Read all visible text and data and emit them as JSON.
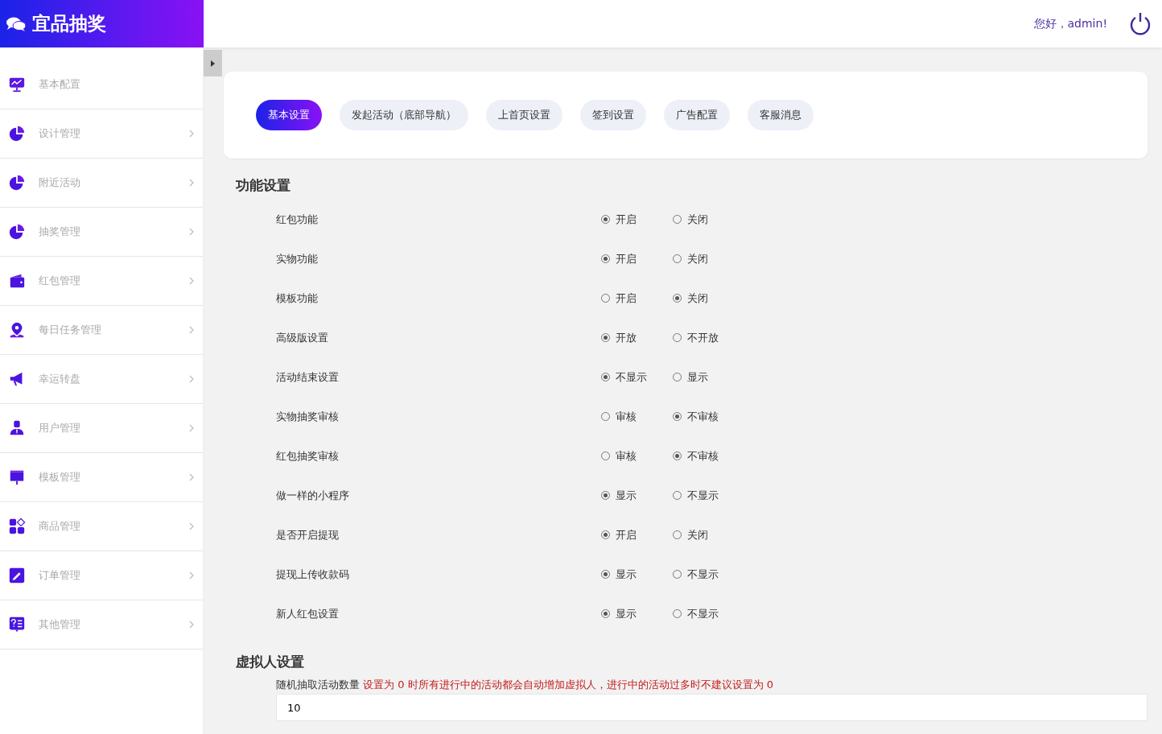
{
  "brand": {
    "title": "宜品抽奖"
  },
  "header": {
    "greeting": "您好，admin!"
  },
  "sidebar": {
    "items": [
      {
        "label": "基本配置",
        "expandable": false
      },
      {
        "label": "设计管理",
        "expandable": true
      },
      {
        "label": "附近活动",
        "expandable": true
      },
      {
        "label": "抽奖管理",
        "expandable": true
      },
      {
        "label": "红包管理",
        "expandable": true
      },
      {
        "label": "每日任务管理",
        "expandable": true
      },
      {
        "label": "幸运转盘",
        "expandable": true
      },
      {
        "label": "用户管理",
        "expandable": true
      },
      {
        "label": "模板管理",
        "expandable": true
      },
      {
        "label": "商品管理",
        "expandable": true
      },
      {
        "label": "订单管理",
        "expandable": true
      },
      {
        "label": "其他管理",
        "expandable": true
      }
    ]
  },
  "tabs": [
    {
      "label": "基本设置",
      "selected": true
    },
    {
      "label": "发起活动（底部导航）",
      "selected": false
    },
    {
      "label": "上首页设置",
      "selected": false
    },
    {
      "label": "签到设置",
      "selected": false
    },
    {
      "label": "广告配置",
      "selected": false
    },
    {
      "label": "客服消息",
      "selected": false
    }
  ],
  "function_settings": {
    "title": "功能设置",
    "rows": [
      {
        "label": "红包功能",
        "options": [
          {
            "label": "开启",
            "selected": true
          },
          {
            "label": "关闭",
            "selected": false
          }
        ]
      },
      {
        "label": "实物功能",
        "options": [
          {
            "label": "开启",
            "selected": true
          },
          {
            "label": "关闭",
            "selected": false
          }
        ]
      },
      {
        "label": "模板功能",
        "options": [
          {
            "label": "开启",
            "selected": false
          },
          {
            "label": "关闭",
            "selected": true
          }
        ]
      },
      {
        "label": "高级版设置",
        "options": [
          {
            "label": "开放",
            "selected": true
          },
          {
            "label": "不开放",
            "selected": false
          }
        ]
      },
      {
        "label": "活动结束设置",
        "options": [
          {
            "label": "不显示",
            "selected": true
          },
          {
            "label": "显示",
            "selected": false
          }
        ]
      },
      {
        "label": "实物抽奖审核",
        "options": [
          {
            "label": "审核",
            "selected": false
          },
          {
            "label": "不审核",
            "selected": true
          }
        ]
      },
      {
        "label": "红包抽奖审核",
        "options": [
          {
            "label": "审核",
            "selected": false
          },
          {
            "label": "不审核",
            "selected": true
          }
        ]
      },
      {
        "label": "做一样的小程序",
        "options": [
          {
            "label": "显示",
            "selected": true
          },
          {
            "label": "不显示",
            "selected": false
          }
        ]
      },
      {
        "label": "是否开启提现",
        "options": [
          {
            "label": "开启",
            "selected": true
          },
          {
            "label": "关闭",
            "selected": false
          }
        ]
      },
      {
        "label": "提现上传收款码",
        "options": [
          {
            "label": "显示",
            "selected": true
          },
          {
            "label": "不显示",
            "selected": false
          }
        ]
      },
      {
        "label": "新人红包设置",
        "options": [
          {
            "label": "显示",
            "selected": true
          },
          {
            "label": "不显示",
            "selected": false
          }
        ]
      }
    ]
  },
  "virtual_settings": {
    "title": "虚拟人设置",
    "fields": [
      {
        "label": "随机抽取活动数量",
        "hint": "设置为 0 时所有进行中的活动都会自动增加虚拟人，进行中的活动过多时不建议设置为 0",
        "value": "10"
      }
    ]
  }
}
